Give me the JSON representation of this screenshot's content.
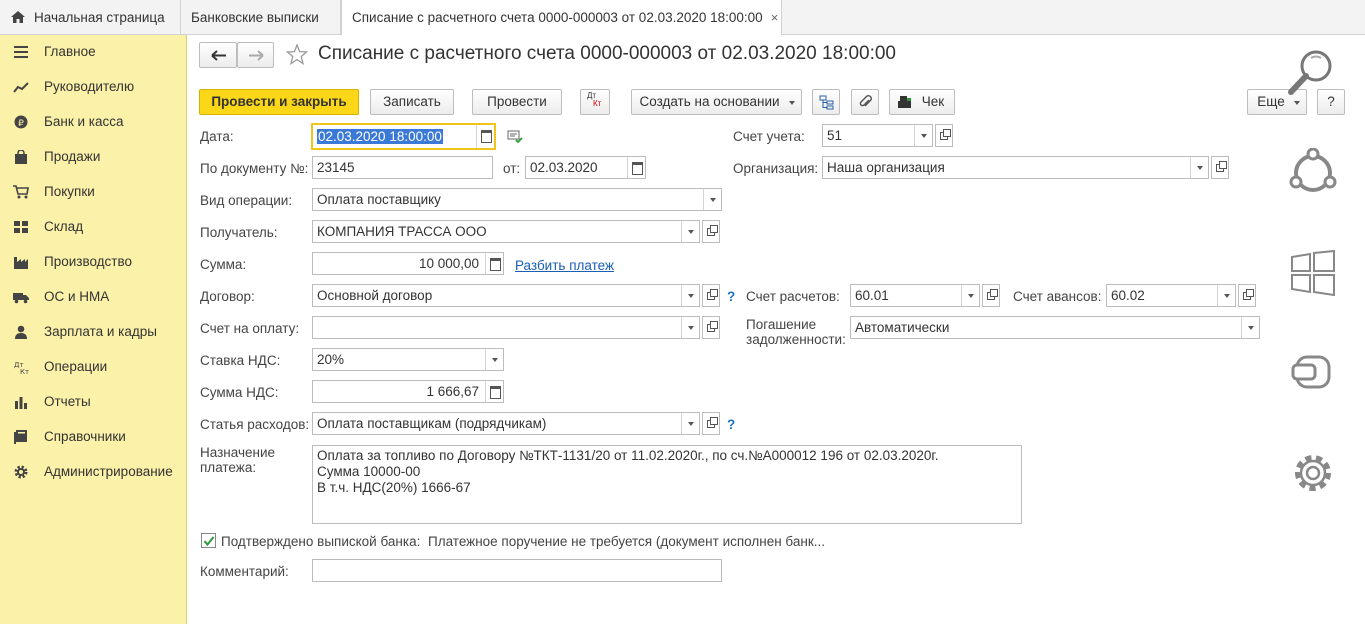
{
  "tabs": [
    {
      "label": "Начальная страница"
    },
    {
      "label": "Банковские выписки"
    },
    {
      "label": "Списание с расчетного счета 0000-000003 от 02.03.2020 18:00:00",
      "close": "×"
    }
  ],
  "sidebar": {
    "items": [
      {
        "label": "Главное",
        "icon": "menu-icon"
      },
      {
        "label": "Руководителю",
        "icon": "chart-line-icon"
      },
      {
        "label": "Банк и касса",
        "icon": "ruble-icon"
      },
      {
        "label": "Продажи",
        "icon": "bag-icon"
      },
      {
        "label": "Покупки",
        "icon": "cart-icon"
      },
      {
        "label": "Склад",
        "icon": "warehouse-icon"
      },
      {
        "label": "Производство",
        "icon": "factory-icon"
      },
      {
        "label": "ОС и НМА",
        "icon": "truck-icon"
      },
      {
        "label": "Зарплата и кадры",
        "icon": "person-icon"
      },
      {
        "label": "Операции",
        "icon": "dt-kt-icon"
      },
      {
        "label": "Отчеты",
        "icon": "bar-chart-icon"
      },
      {
        "label": "Справочники",
        "icon": "book-icon"
      },
      {
        "label": "Администрирование",
        "icon": "gear-icon"
      }
    ]
  },
  "header": {
    "title": "Списание с расчетного счета 0000-000003 от 02.03.2020 18:00:00"
  },
  "toolbar": {
    "post_close": "Провести и закрыть",
    "save": "Записать",
    "post": "Провести",
    "dtkt_top": "Дт",
    "dtkt_bottom": "Кт",
    "create_based": "Создать на основании",
    "receipt": "Чек",
    "more": "Еще",
    "help": "?"
  },
  "form": {
    "date_label": "Дата:",
    "date_value": "02.03.2020 18:00:00",
    "account_label": "Счет учета:",
    "account_value": "51",
    "doc_num_label": "По документу №:",
    "doc_num_value": "23145",
    "from_label": "от:",
    "from_value": "02.03.2020",
    "org_label": "Организация:",
    "org_value": "Наша организация",
    "op_type_label": "Вид операции:",
    "op_type_value": "Оплата поставщику",
    "recipient_label": "Получатель:",
    "recipient_value": "КОМПАНИЯ ТРАССА ООО",
    "sum_label": "Сумма:",
    "sum_value": "10 000,00",
    "split_link": "Разбить платеж",
    "contract_label": "Договор:",
    "contract_value": "Основной договор",
    "settle_label": "Счет расчетов:",
    "settle_value": "60.01",
    "advance_label": "Счет авансов:",
    "advance_value": "60.02",
    "invoice_label": "Счет на оплату:",
    "invoice_value": "",
    "debt_label_1": "Погашение",
    "debt_label_2": "задолженности:",
    "debt_value": "Автоматически",
    "vat_rate_label": "Ставка НДС:",
    "vat_rate_value": "20%",
    "vat_sum_label": "Сумма НДС:",
    "vat_sum_value": "1 666,67",
    "expense_label": "Статья расходов:",
    "expense_value": "Оплата поставщикам (подрядчикам)",
    "purpose_label_1": "Назначение",
    "purpose_label_2": "платежа:",
    "purpose_line1": "Оплата за топливо по Договору №ТКТ-1131/20 от 11.02.2020г., по сч.№А000012 196 от 02.03.2020г.",
    "purpose_line2": "Сумма 10000-00",
    "purpose_line3": "В т.ч. НДС(20%) 1666-67",
    "confirmed_label": "Подтверждено выпиской банка:",
    "confirmed_note": "Платежное поручение не требуется (документ исполнен банк...",
    "comment_label": "Комментарий:",
    "comment_value": "",
    "help_mark": "?"
  },
  "colors": {
    "sidebar_bg": "#fbf1a9",
    "primary_btn": "#fcd718",
    "link": "#1a5fb4",
    "help": "#1f72c9"
  }
}
